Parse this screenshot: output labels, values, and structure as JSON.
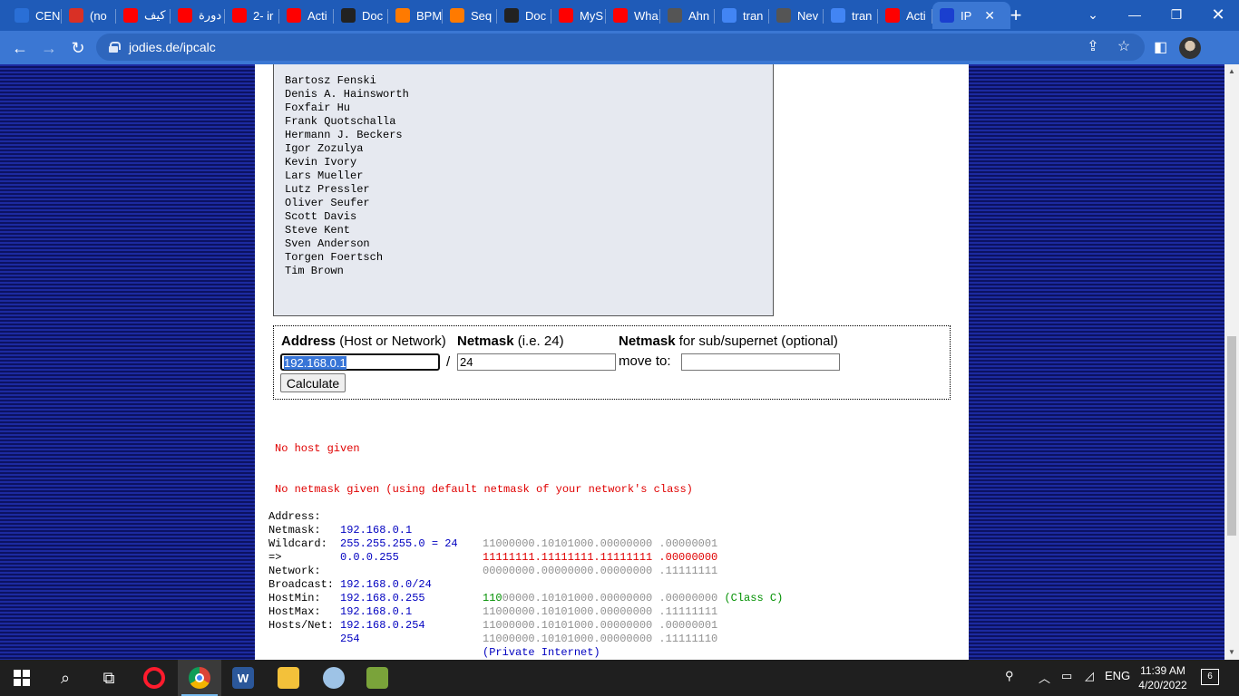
{
  "browser": {
    "tabs": [
      {
        "label": "CEN",
        "color": "#2a6fd6"
      },
      {
        "label": "(no",
        "color": "#d93025"
      },
      {
        "label": "كيف",
        "color": "#ff0000"
      },
      {
        "label": "دورة",
        "color": "#ff0000"
      },
      {
        "label": "2- ir",
        "color": "#ff0000"
      },
      {
        "label": "Acti",
        "color": "#ff0000"
      },
      {
        "label": "Doc",
        "color": "#222222"
      },
      {
        "label": "BPM",
        "color": "#ff7a00"
      },
      {
        "label": "Seq",
        "color": "#ff7a00"
      },
      {
        "label": "Doc",
        "color": "#222222"
      },
      {
        "label": "MyS",
        "color": "#ff0000"
      },
      {
        "label": "Wha",
        "color": "#ff0000"
      },
      {
        "label": "Ahn",
        "color": "#555555"
      },
      {
        "label": "tran",
        "color": "#4285f4"
      },
      {
        "label": "Nev",
        "color": "#555555"
      },
      {
        "label": "tran",
        "color": "#4285f4"
      },
      {
        "label": "Acti",
        "color": "#ff0000"
      },
      {
        "label": "IP",
        "color": "#1a3fcf"
      }
    ],
    "url": "jodies.de/ipcalc"
  },
  "credits": [
    "Bartosz Fenski",
    "Denis A. Hainsworth",
    "Foxfair Hu",
    "Frank Quotschalla",
    "Hermann J. Beckers",
    "Igor Zozulya",
    "Kevin Ivory",
    "Lars Mueller",
    "Lutz Pressler",
    "Oliver Seufer",
    "Scott Davis",
    "Steve Kent",
    "Sven Anderson",
    "Torgen Foertsch",
    "Tim Brown"
  ],
  "form": {
    "address_bold": "Address",
    "address_hint": "(Host or Network)",
    "netmask_bold": "Netmask",
    "netmask_hint": "(i.e. 24)",
    "subnet_bold": "Netmask",
    "subnet_hint": "for sub/supernet (optional)",
    "address_value": "192.168.0.1",
    "slash": "/",
    "netmask_value": "24",
    "move_to_label": "move to:",
    "move_to_value": "",
    "calculate_label": "Calculate"
  },
  "errors": [
    "No host given",
    "No netmask given (using default netmask of your network's class)"
  ],
  "result": {
    "address": {
      "key": "Address:",
      "value": "192.168.0.1",
      "binary": "11000000.10101000.00000000 .00000001"
    },
    "netmask": {
      "key": "Netmask:",
      "value": "255.255.255.0 = 24",
      "binary": "11111111.11111111.11111111 .00000000"
    },
    "wildcard": {
      "key": "Wildcard:",
      "value": "0.0.0.255",
      "binary": "00000000.00000000.00000000 .11111111"
    },
    "arrow": "=>",
    "network": {
      "key": "Network:",
      "value": "192.168.0.0/24",
      "binary_prefix": "110",
      "binary_rest": "00000.10101000.00000000 .00000000",
      "class": "(Class C)"
    },
    "broadcast": {
      "key": "Broadcast:",
      "value": "192.168.0.255",
      "binary": "11000000.10101000.00000000 .11111111"
    },
    "hostmin": {
      "key": "HostMin:",
      "value": "192.168.0.1",
      "binary": "11000000.10101000.00000000 .00000001"
    },
    "hostmax": {
      "key": "HostMax:",
      "value": "192.168.0.254",
      "binary": "11000000.10101000.00000000 .11111110"
    },
    "hosts": {
      "key": "Hosts/Net:",
      "value": "254",
      "note": "(Private Internet)"
    }
  },
  "taskbar": {
    "language": "ENG",
    "time": "11:39 AM",
    "date": "4/20/2022",
    "notifications": "6"
  }
}
